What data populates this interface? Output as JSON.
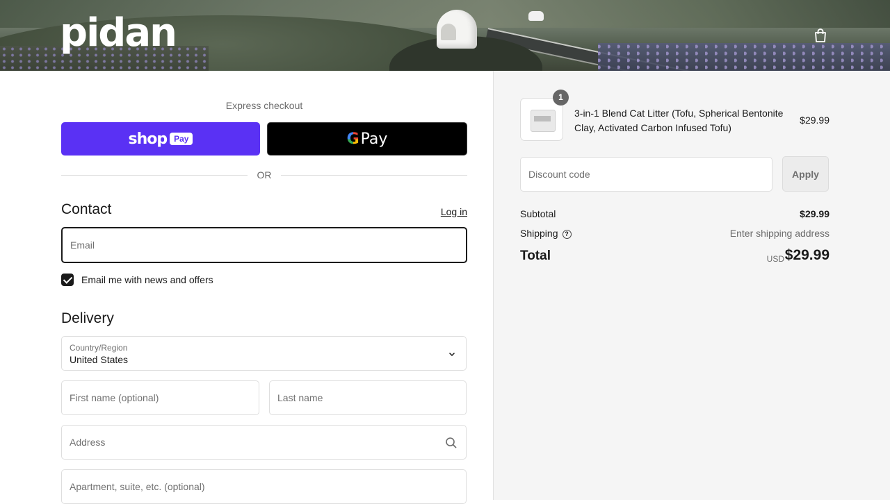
{
  "header": {
    "logo_text": "pidan",
    "cart_icon": "shopping-bag-icon"
  },
  "express": {
    "label": "Express checkout",
    "shop_pay": {
      "shop_text": "shop",
      "pay_text": "Pay",
      "color": "#5a31f4"
    },
    "google_pay": {
      "g_text": "G",
      "pay_text": "Pay"
    },
    "or_text": "OR"
  },
  "contact": {
    "title": "Contact",
    "login_link": "Log in",
    "email_placeholder": "Email",
    "newsletter_label": "Email me with news and offers",
    "newsletter_checked": true
  },
  "delivery": {
    "title": "Delivery",
    "country_label": "Country/Region",
    "country_value": "United States",
    "first_name_placeholder": "First name (optional)",
    "last_name_placeholder": "Last name",
    "address_placeholder": "Address",
    "apartment_placeholder": "Apartment, suite, etc. (optional)"
  },
  "order_summary": {
    "product": {
      "quantity": "1",
      "name": "3-in-1 Blend Cat Litter (Tofu, Spherical Bentonite Clay, Activated Carbon Infused Tofu)",
      "price": "$29.99"
    },
    "discount_placeholder": "Discount code",
    "apply_label": "Apply",
    "subtotal_label": "Subtotal",
    "subtotal_value": "$29.99",
    "shipping_label": "Shipping",
    "shipping_value": "Enter shipping address",
    "total_label": "Total",
    "total_currency": "USD",
    "total_value": "$29.99"
  }
}
